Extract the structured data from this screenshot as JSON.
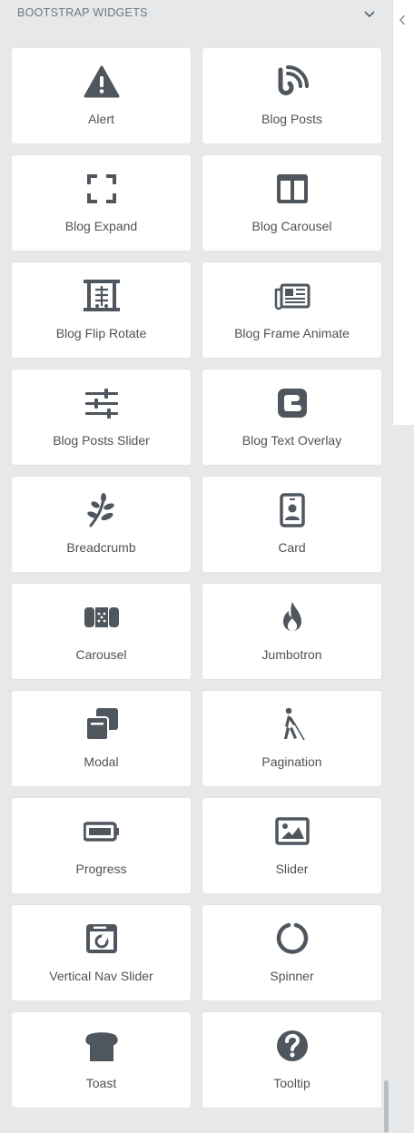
{
  "panel": {
    "title": "BOOTSTRAP WIDGETS",
    "chevron_icon": "chevron-down-icon",
    "collapse_icon": "chevron-left-icon"
  },
  "colors": {
    "icon": "#4f565e",
    "label": "#4e5257",
    "card": "#ffffff",
    "background": "#e6e8ea"
  },
  "widgets": [
    {
      "label": "Alert",
      "icon": "warning-icon"
    },
    {
      "label": "Blog Posts",
      "icon": "rss-icon"
    },
    {
      "label": "Blog Expand",
      "icon": "expand-icon"
    },
    {
      "label": "Blog Carousel",
      "icon": "columns-icon"
    },
    {
      "label": "Blog Flip Rotate",
      "icon": "projector-screen-icon"
    },
    {
      "label": "Blog Frame Animate",
      "icon": "newspaper-icon"
    },
    {
      "label": "Blog Posts Slider",
      "icon": "sliders-icon"
    },
    {
      "label": "Blog Text Overlay",
      "icon": "blogger-icon"
    },
    {
      "label": "Breadcrumb",
      "icon": "leaf-icon"
    },
    {
      "label": "Card",
      "icon": "id-badge-icon"
    },
    {
      "label": "Carousel",
      "icon": "band-aid-icon"
    },
    {
      "label": "Jumbotron",
      "icon": "fire-icon"
    },
    {
      "label": "Modal",
      "icon": "clone-icon"
    },
    {
      "label": "Pagination",
      "icon": "blind-walking-icon"
    },
    {
      "label": "Progress",
      "icon": "battery-icon"
    },
    {
      "label": "Slider",
      "icon": "image-icon"
    },
    {
      "label": "Vertical Nav Slider",
      "icon": "camera-window-icon"
    },
    {
      "label": "Spinner",
      "icon": "circle-notch-icon"
    },
    {
      "label": "Toast",
      "icon": "bread-icon"
    },
    {
      "label": "Tooltip",
      "icon": "question-circle-icon"
    }
  ]
}
